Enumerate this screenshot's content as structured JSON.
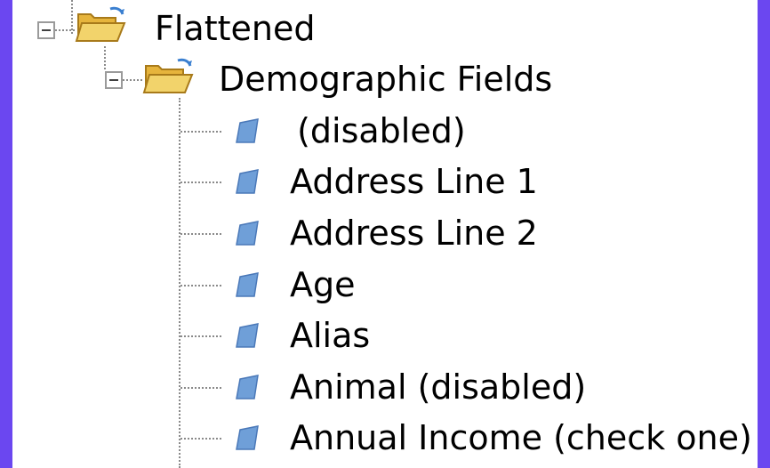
{
  "colors": {
    "frame": "#6b47f0",
    "panel": "#ffffff",
    "text": "#000000",
    "dotted_line": "#8a8a8a",
    "folder_body": "#f2d36b",
    "folder_back": "#e6b43c",
    "leaf_icon": "#6f9fd8"
  },
  "tree": {
    "root": {
      "label": "Flattened",
      "icon": "folder-open-icon",
      "expanded": true,
      "children": [
        {
          "label": "Demographic Fields",
          "icon": "folder-open-icon",
          "expanded": true,
          "children": [
            {
              "label": " (disabled)",
              "icon": "field-icon"
            },
            {
              "label": "Address Line 1",
              "icon": "field-icon"
            },
            {
              "label": "Address Line 2",
              "icon": "field-icon"
            },
            {
              "label": "Age",
              "icon": "field-icon"
            },
            {
              "label": "Alias",
              "icon": "field-icon"
            },
            {
              "label": "Animal (disabled)",
              "icon": "field-icon"
            },
            {
              "label": "Annual Income (check one)",
              "icon": "field-icon"
            }
          ]
        }
      ]
    }
  }
}
